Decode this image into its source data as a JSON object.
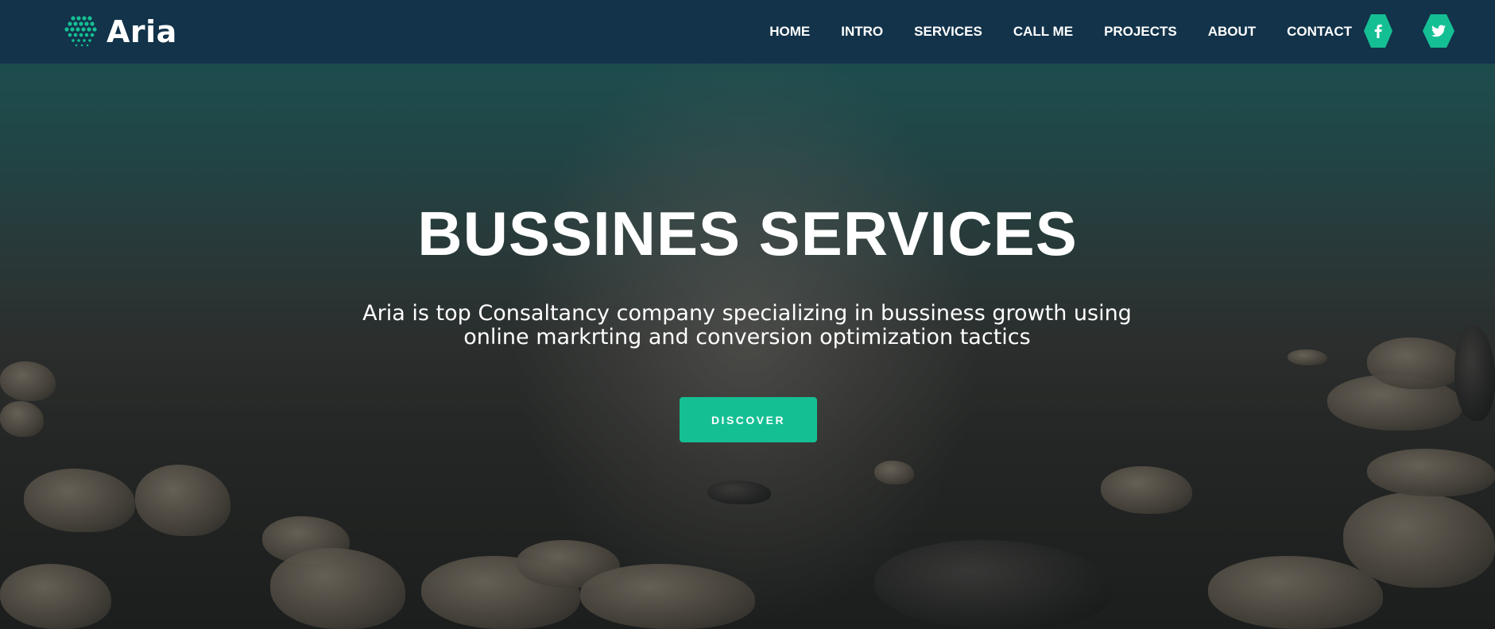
{
  "brand": {
    "name": "Aria",
    "accent_color": "#15bf94",
    "navbar_color": "#12334a"
  },
  "nav": {
    "items": [
      {
        "label": "HOME"
      },
      {
        "label": "INTRO"
      },
      {
        "label": "SERVICES"
      },
      {
        "label": "CALL ME"
      },
      {
        "label": "PROJECTS"
      },
      {
        "label": "ABOUT"
      },
      {
        "label": "CONTACT"
      }
    ],
    "social": [
      {
        "icon": "facebook-icon"
      },
      {
        "icon": "twitter-icon"
      }
    ]
  },
  "hero": {
    "title": "BUSSINES SERVICES",
    "subtitle": "Aria is top Consaltancy company specializing in bussiness growth using online markrting and conversion optimization tactics",
    "button_label": "DISCOVER",
    "background": "lake-with-rocks-photo"
  }
}
